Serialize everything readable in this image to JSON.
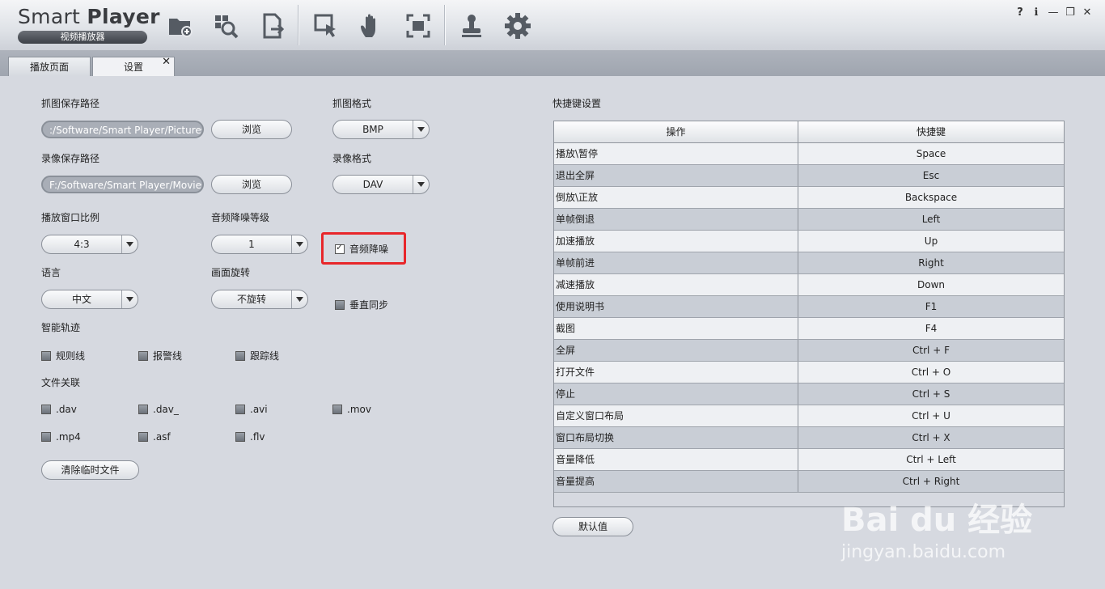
{
  "app": {
    "title_light": "Smart ",
    "title_bold": "Player",
    "subtitle": "视频播放器"
  },
  "toolbar_icons": [
    "open-folder-icon",
    "search-window-icon",
    "export-file-icon",
    "select-pointer-icon",
    "hand-icon",
    "fullscreen-icon",
    "stamp-icon",
    "gear-icon"
  ],
  "window_controls": {
    "help": "?",
    "info": "ℹ",
    "minimize": "—",
    "restore": "❐",
    "close": "✕"
  },
  "tabs": [
    {
      "label": "播放页面"
    },
    {
      "label": "设置",
      "close": "✕"
    }
  ],
  "settings": {
    "snapshot_path_label": "抓图保存路径",
    "snapshot_path_value": ":/Software/Smart Player/Pictures/",
    "browse_label": "浏览",
    "snapshot_format_label": "抓图格式",
    "snapshot_format_value": "BMP",
    "record_path_label": "录像保存路径",
    "record_path_value": "F:/Software/Smart Player/Movies/",
    "record_format_label": "录像格式",
    "record_format_value": "DAV",
    "aspect_label": "播放窗口比例",
    "aspect_value": "4:3",
    "denoise_level_label": "音频降噪等级",
    "denoise_level_value": "1",
    "denoise_label": "音频降噪",
    "language_label": "语言",
    "language_value": "中文",
    "rotate_label": "画面旋转",
    "rotate_value": "不旋转",
    "vsync_label": "垂直同步",
    "smart_track_label": "智能轨迹",
    "rule_line": "规则线",
    "alarm_line": "报警线",
    "track_line": "跟踪线",
    "file_assoc_label": "文件关联",
    "ext_dav": ".dav",
    "ext_dav_": ".dav_",
    "ext_avi": ".avi",
    "ext_mov": ".mov",
    "ext_mp4": ".mp4",
    "ext_asf": ".asf",
    "ext_flv": ".flv",
    "clear_temp": "清除临时文件"
  },
  "shortcuts": {
    "title": "快捷键设置",
    "col_action": "操作",
    "col_key": "快捷键",
    "rows": [
      {
        "action": "播放\\暂停",
        "key": "Space"
      },
      {
        "action": "退出全屏",
        "key": "Esc"
      },
      {
        "action": "倒放\\正放",
        "key": "Backspace"
      },
      {
        "action": "单帧倒退",
        "key": "Left"
      },
      {
        "action": "加速播放",
        "key": "Up"
      },
      {
        "action": "单帧前进",
        "key": "Right"
      },
      {
        "action": "减速播放",
        "key": "Down"
      },
      {
        "action": "使用说明书",
        "key": "F1"
      },
      {
        "action": "截图",
        "key": "F4"
      },
      {
        "action": "全屏",
        "key": "Ctrl + F"
      },
      {
        "action": "打开文件",
        "key": "Ctrl + O"
      },
      {
        "action": "停止",
        "key": "Ctrl + S"
      },
      {
        "action": "自定义窗口布局",
        "key": "Ctrl + U"
      },
      {
        "action": "窗口布局切换",
        "key": "Ctrl + X"
      },
      {
        "action": "音量降低",
        "key": "Ctrl + Left"
      },
      {
        "action": "音量提高",
        "key": "Ctrl + Right"
      }
    ],
    "default_button": "默认值"
  },
  "watermark": {
    "logo": "Bai du 经验",
    "url": "jingyan.baidu.com"
  }
}
